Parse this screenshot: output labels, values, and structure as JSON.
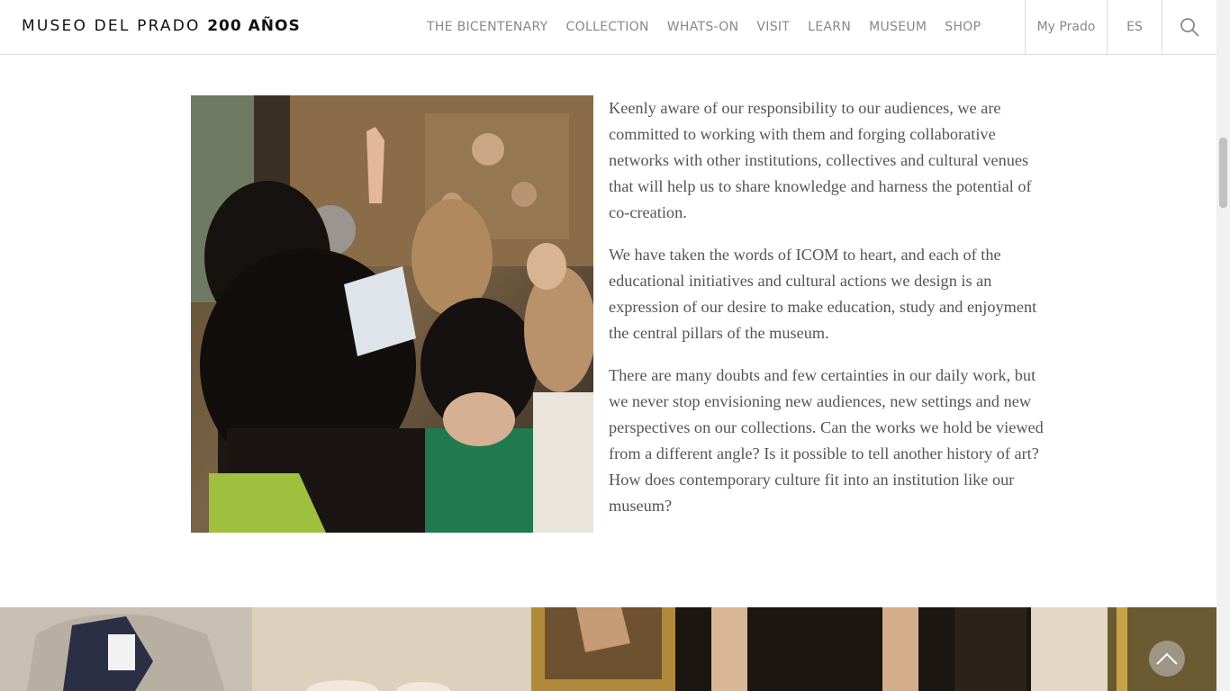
{
  "header": {
    "logo_main": "MUSEO DEL PRADO",
    "logo_bold": "200 AÑOS",
    "nav": [
      "THE BICENTENARY",
      "COLLECTION",
      "WHATS-ON",
      "VISIT",
      "LEARN",
      "MUSEUM",
      "SHOP"
    ],
    "my_prado": "My Prado",
    "language": "ES",
    "search_icon": "search-icon"
  },
  "content": {
    "paragraphs": [
      "Keenly aware of our responsibility to our audiences, we are committed to working with them and forging collaborative networks with other institutions, collectives and cultural venues that will help us to share knowledge and harness the potential of co-creation.",
      "We have taken the words of ICOM to heart, and each of the educational initiatives and cultural actions we design is an expression of our desire to make education, study and enjoyment the central pillars of the museum.",
      "There are many doubts and few certainties in our daily work, but we never stop envisioning new audiences, new settings and new perspectives on our collections. Can the works we hold be viewed from a different angle? Is it possible to tell another history of art? How does contemporary culture fit into an institution like our museum?"
    ]
  },
  "controls": {
    "back_to_top_icon": "chevron-up-icon"
  },
  "colors": {
    "nav_text": "#888888",
    "body_text": "#555555",
    "border": "#dcdcdc"
  }
}
